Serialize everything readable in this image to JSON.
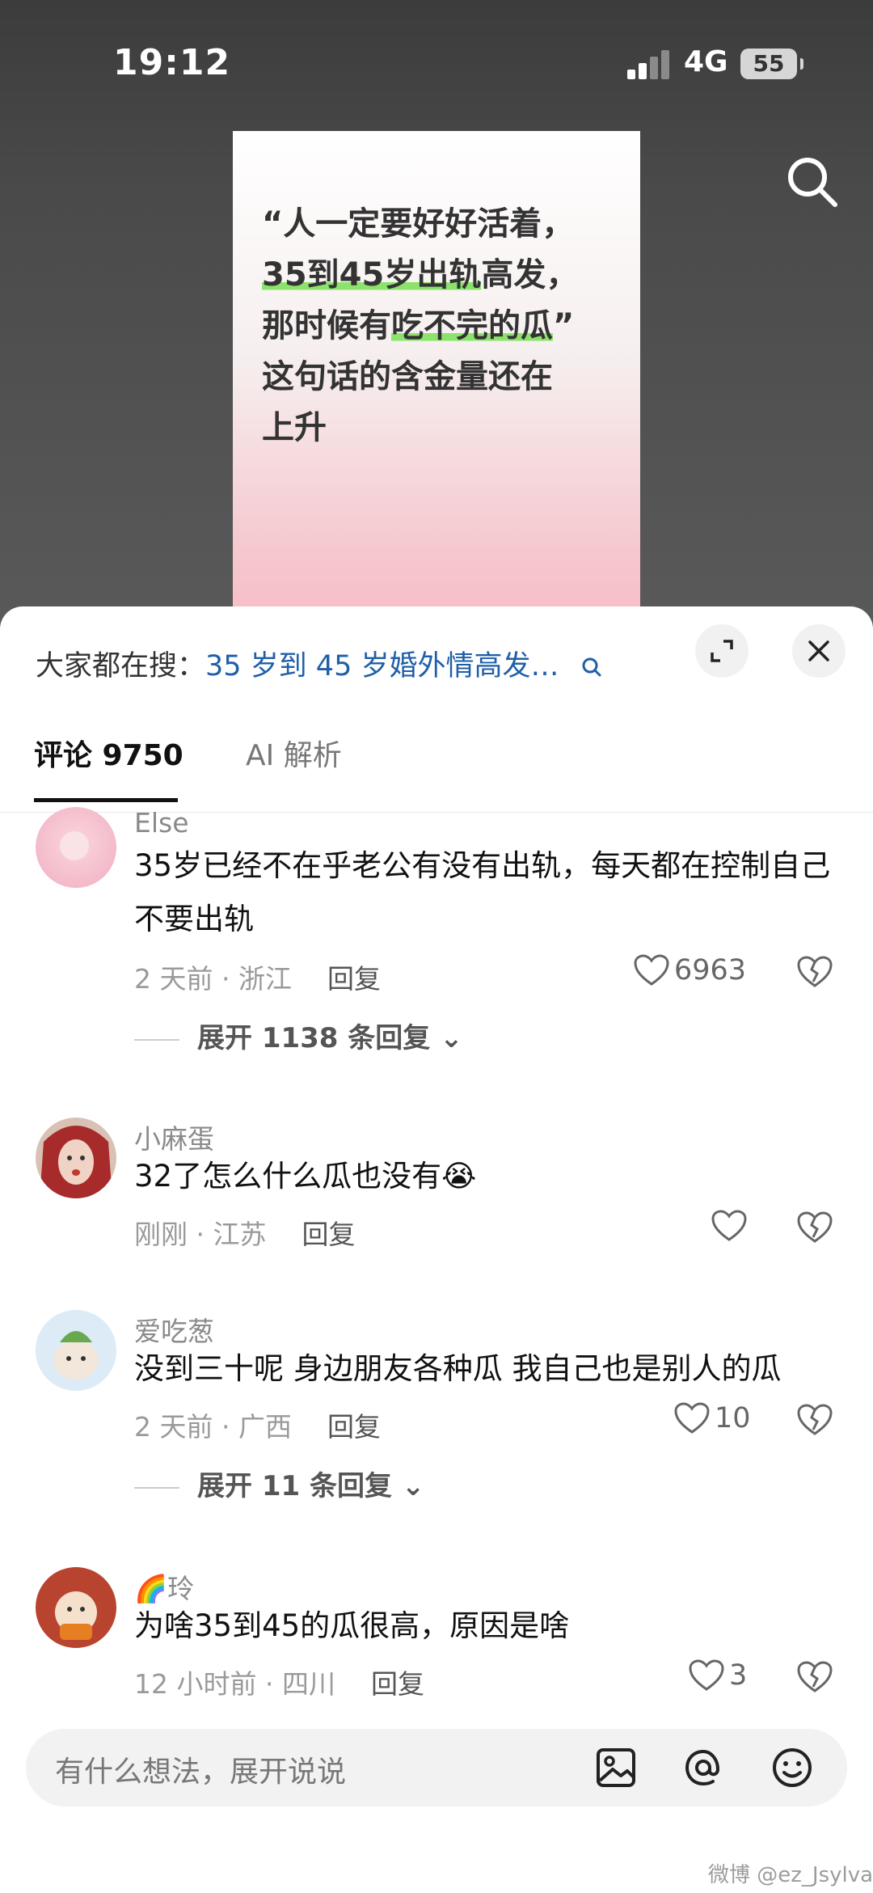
{
  "status_bar": {
    "time": "19:12",
    "network": "4G",
    "battery": "55"
  },
  "video_card": {
    "lines": [
      {
        "pre": "“人一定要好好活着，",
        "hl": "",
        "post": ""
      },
      {
        "pre": "",
        "hl": "35到45岁出轨",
        "post": "高发，"
      },
      {
        "pre": "那时候有",
        "hl": "吃不完的瓜",
        "post": "”"
      },
      {
        "pre": "这句话的含金量还在",
        "hl": "",
        "post": ""
      },
      {
        "pre": "上升",
        "hl": "",
        "post": ""
      }
    ]
  },
  "sheet": {
    "search_prefix": "大家都在搜：",
    "search_query": "35 岁到 45 岁婚外情高发…",
    "tabs": {
      "comments": "评论 9750",
      "ai": "AI 解析"
    }
  },
  "comments": [
    {
      "name": "Else",
      "text": "35岁已经不在乎老公有没有出轨，每天都在控制自己不要出轨",
      "meta": "2 天前 · 浙江",
      "reply": "回复",
      "likes": "6963",
      "expand": "展开 1138 条回复 ⌄"
    },
    {
      "name": "小麻蛋",
      "text": "32了怎么什么瓜也没有",
      "emoji": "😭",
      "meta": "刚刚 · 江苏",
      "reply": "回复",
      "likes": ""
    },
    {
      "name": "爱吃葱",
      "text": "没到三十呢 身边朋友各种瓜 我自己也是别人的瓜",
      "meta": "2 天前 · 广西",
      "reply": "回复",
      "likes": "10",
      "expand": "展开 11 条回复 ⌄"
    },
    {
      "name": "🌈玲",
      "text": "为啥35到45的瓜很高，原因是啥",
      "meta": "12 小时前 · 四川",
      "reply": "回复",
      "likes": "3"
    }
  ],
  "input": {
    "placeholder": "有什么想法，展开说说"
  },
  "watermark": "微博 @ez_Jsylva",
  "colors": {
    "link_blue": "#1f5fa8",
    "highlight_green": "#8be36b",
    "card_pink": "#f7b9c2"
  }
}
